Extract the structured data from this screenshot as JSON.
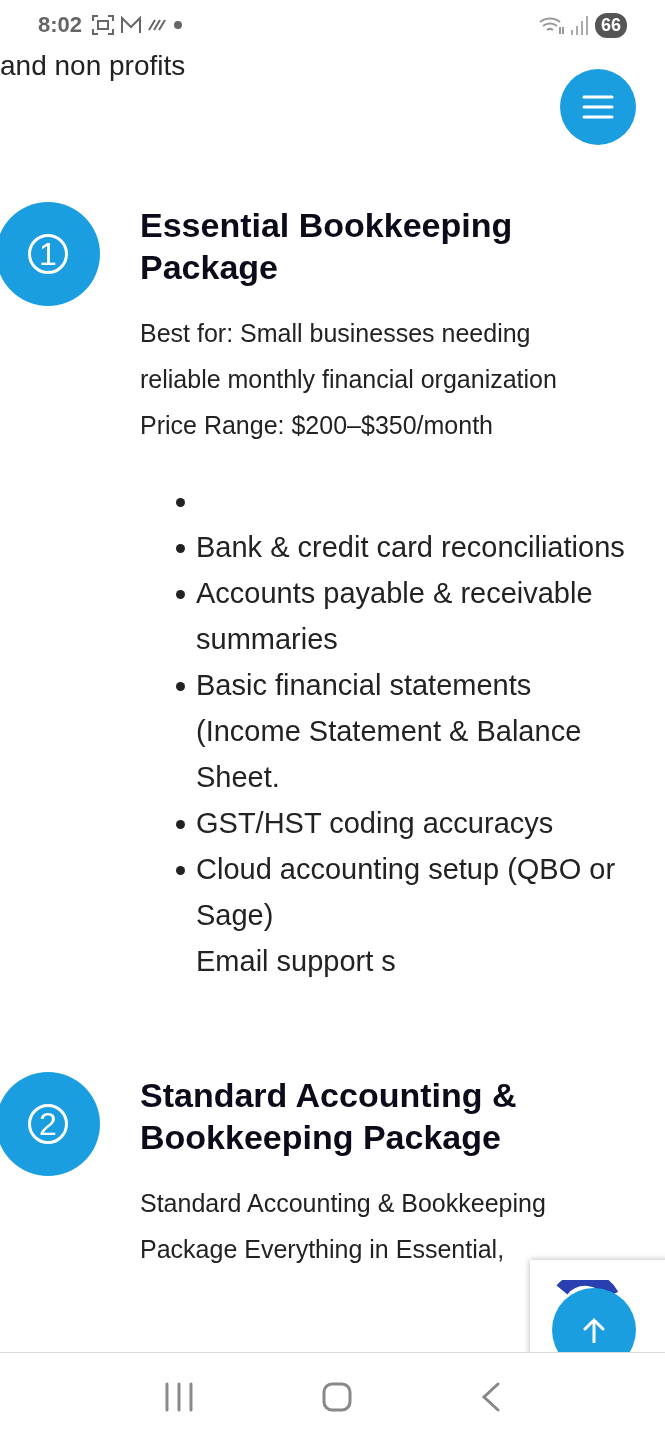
{
  "status_bar": {
    "time": "8:02",
    "battery": "66"
  },
  "top_text": "and non profits",
  "packages": [
    {
      "number": "1",
      "title": "Essential Bookkeeping Package",
      "description": [
        "Best for: Small businesses needing reliable monthly financial organization",
        "Price Range: $200–$350/month"
      ],
      "items": [
        {
          "kind": "bullet"
        },
        {
          "kind": "bullet",
          "text": "Bank & credit card reconciliations"
        },
        {
          "kind": "bullet",
          "text": "Accounts payable & receivable summaries"
        },
        {
          "kind": "bullet",
          "text": "Basic financial statements (Income Statement & Balance Sheet."
        },
        {
          "kind": "bullet",
          "text": "GST/HST coding accuracys"
        },
        {
          "kind": "bullet",
          "text": "Cloud accounting setup (QBO or Sage)"
        },
        {
          "kind": "plain",
          "text": "Email support s"
        }
      ]
    },
    {
      "number": "2",
      "title": "Standard Accounting & Bookkeeping Package",
      "description": [
        "Standard Accounting & Bookkeeping Package Everything in Essential,"
      ]
    }
  ]
}
